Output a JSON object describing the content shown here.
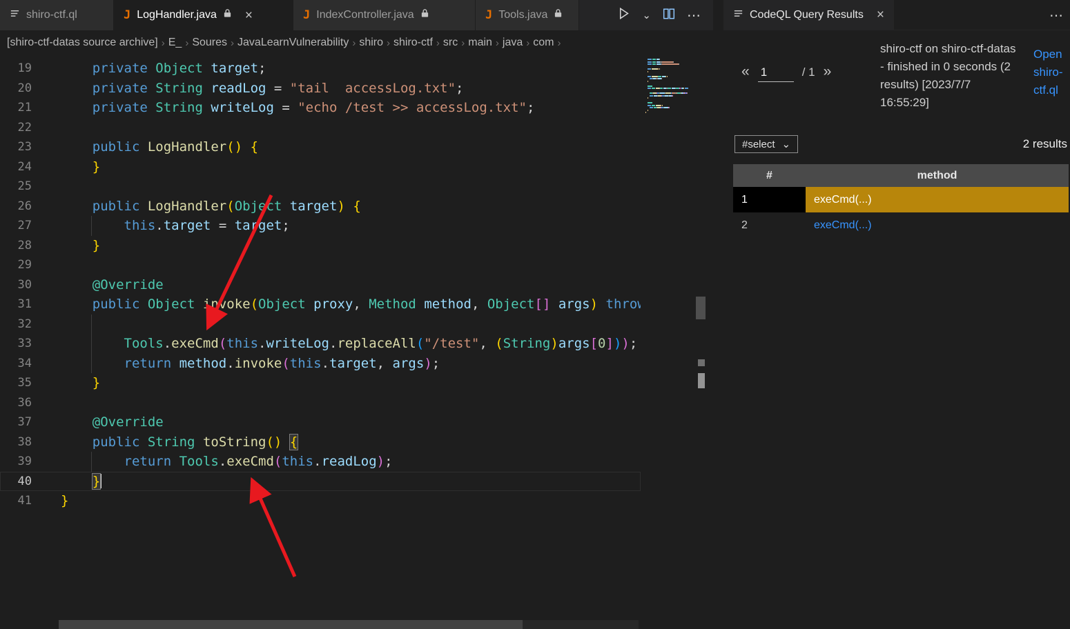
{
  "icons": {
    "java_badge": "J",
    "close": "×",
    "more": "⋯",
    "run_chevron": "⌄",
    "select_chevron": "⌄",
    "breadcrumb_separator": "›"
  },
  "colors": {
    "selected_result_bg": "#b8860b",
    "link_blue": "#3794ff",
    "annotation_arrow_red": "#e8191f",
    "java_icon_orange": "#e76f00"
  },
  "tabs": [
    {
      "label": "shiro-ctf.ql"
    },
    {
      "label": "LogHandler.java"
    },
    {
      "label": "IndexController.java"
    },
    {
      "label": "Tools.java"
    }
  ],
  "breadcrumb": {
    "items": [
      "[shiro-ctf-datas source archive]",
      "E_",
      "Soures",
      "JavaLearnVulnerability",
      "shiro",
      "shiro-ctf",
      "src",
      "main",
      "java",
      "com"
    ]
  },
  "code": {
    "lines": [
      {
        "num": "19",
        "tokens": [
          [
            "    ",
            "p"
          ],
          [
            "private",
            "kw"
          ],
          [
            " ",
            "p"
          ],
          [
            "Object",
            "type"
          ],
          [
            " ",
            "p"
          ],
          [
            "target",
            "var"
          ],
          [
            ";",
            "p"
          ]
        ]
      },
      {
        "num": "20",
        "tokens": [
          [
            "    ",
            "p"
          ],
          [
            "private",
            "kw"
          ],
          [
            " ",
            "p"
          ],
          [
            "String",
            "type"
          ],
          [
            " ",
            "p"
          ],
          [
            "readLog",
            "var"
          ],
          [
            " = ",
            "p"
          ],
          [
            "\"tail  accessLog.txt\"",
            "str"
          ],
          [
            ";",
            "p"
          ]
        ]
      },
      {
        "num": "21",
        "tokens": [
          [
            "    ",
            "p"
          ],
          [
            "private",
            "kw"
          ],
          [
            " ",
            "p"
          ],
          [
            "String",
            "type"
          ],
          [
            " ",
            "p"
          ],
          [
            "writeLog",
            "var"
          ],
          [
            " = ",
            "p"
          ],
          [
            "\"echo /test >> accessLog.txt\"",
            "str"
          ],
          [
            ";",
            "p"
          ]
        ]
      },
      {
        "num": "22",
        "tokens": []
      },
      {
        "num": "23",
        "tokens": [
          [
            "    ",
            "p"
          ],
          [
            "public",
            "kw"
          ],
          [
            " ",
            "p"
          ],
          [
            "LogHandler",
            "fn"
          ],
          [
            "()",
            "b1"
          ],
          [
            " ",
            "p"
          ],
          [
            "{",
            "b1"
          ]
        ]
      },
      {
        "num": "24",
        "tokens": [
          [
            "    ",
            "p"
          ],
          [
            "}",
            "b1"
          ]
        ]
      },
      {
        "num": "25",
        "tokens": []
      },
      {
        "num": "26",
        "tokens": [
          [
            "    ",
            "p"
          ],
          [
            "public",
            "kw"
          ],
          [
            " ",
            "p"
          ],
          [
            "LogHandler",
            "fn"
          ],
          [
            "(",
            "b1"
          ],
          [
            "Object",
            "type"
          ],
          [
            " ",
            "p"
          ],
          [
            "target",
            "var"
          ],
          [
            ")",
            "b1"
          ],
          [
            " ",
            "p"
          ],
          [
            "{",
            "b1"
          ]
        ]
      },
      {
        "num": "27",
        "tokens": [
          [
            "        ",
            "p"
          ],
          [
            "this",
            "kw"
          ],
          [
            ".",
            "p"
          ],
          [
            "target",
            "var"
          ],
          [
            " = ",
            "p"
          ],
          [
            "target",
            "var"
          ],
          [
            ";",
            "p"
          ]
        ]
      },
      {
        "num": "28",
        "tokens": [
          [
            "    ",
            "p"
          ],
          [
            "}",
            "b1"
          ]
        ]
      },
      {
        "num": "29",
        "tokens": []
      },
      {
        "num": "30",
        "tokens": [
          [
            "    ",
            "p"
          ],
          [
            "@Override",
            "type"
          ]
        ]
      },
      {
        "num": "31",
        "tokens": [
          [
            "    ",
            "p"
          ],
          [
            "public",
            "kw"
          ],
          [
            " ",
            "p"
          ],
          [
            "Object",
            "type"
          ],
          [
            " ",
            "p"
          ],
          [
            "invoke",
            "fn"
          ],
          [
            "(",
            "b1"
          ],
          [
            "Object",
            "type"
          ],
          [
            " ",
            "p"
          ],
          [
            "proxy",
            "var"
          ],
          [
            ", ",
            "p"
          ],
          [
            "Method",
            "type"
          ],
          [
            " ",
            "p"
          ],
          [
            "method",
            "var"
          ],
          [
            ", ",
            "p"
          ],
          [
            "Object",
            "type"
          ],
          [
            "[]",
            "b2"
          ],
          [
            " ",
            "p"
          ],
          [
            "args",
            "var"
          ],
          [
            ")",
            "b1"
          ],
          [
            " ",
            "p"
          ],
          [
            "throws",
            "kw"
          ]
        ]
      },
      {
        "num": "32",
        "tokens": []
      },
      {
        "num": "33",
        "tokens": [
          [
            "        ",
            "p"
          ],
          [
            "Tools",
            "type"
          ],
          [
            ".",
            "p"
          ],
          [
            "exeCmd",
            "fn"
          ],
          [
            "(",
            "b2"
          ],
          [
            "this",
            "kw"
          ],
          [
            ".",
            "p"
          ],
          [
            "writeLog",
            "var"
          ],
          [
            ".",
            "p"
          ],
          [
            "replaceAll",
            "fn"
          ],
          [
            "(",
            "b3"
          ],
          [
            "\"/test\"",
            "str"
          ],
          [
            ", ",
            "p"
          ],
          [
            "(",
            "b1"
          ],
          [
            "String",
            "type"
          ],
          [
            ")",
            "b1"
          ],
          [
            "args",
            "var"
          ],
          [
            "[",
            "b2"
          ],
          [
            "0",
            "num"
          ],
          [
            "]",
            "b2"
          ],
          [
            ")",
            "b3"
          ],
          [
            ")",
            "b2"
          ],
          [
            ";",
            "p"
          ]
        ]
      },
      {
        "num": "34",
        "tokens": [
          [
            "        ",
            "p"
          ],
          [
            "return",
            "kw"
          ],
          [
            " ",
            "p"
          ],
          [
            "method",
            "var"
          ],
          [
            ".",
            "p"
          ],
          [
            "invoke",
            "fn"
          ],
          [
            "(",
            "b2"
          ],
          [
            "this",
            "kw"
          ],
          [
            ".",
            "p"
          ],
          [
            "target",
            "var"
          ],
          [
            ", ",
            "p"
          ],
          [
            "args",
            "var"
          ],
          [
            ")",
            "b2"
          ],
          [
            ";",
            "p"
          ]
        ]
      },
      {
        "num": "35",
        "tokens": [
          [
            "    ",
            "p"
          ],
          [
            "}",
            "b1"
          ]
        ]
      },
      {
        "num": "36",
        "tokens": []
      },
      {
        "num": "37",
        "tokens": [
          [
            "    ",
            "p"
          ],
          [
            "@Override",
            "type"
          ]
        ]
      },
      {
        "num": "38",
        "tokens": [
          [
            "    ",
            "p"
          ],
          [
            "public",
            "kw"
          ],
          [
            " ",
            "p"
          ],
          [
            "String",
            "type"
          ],
          [
            " ",
            "p"
          ],
          [
            "toString",
            "fn"
          ],
          [
            "()",
            "b1"
          ],
          [
            " ",
            "p"
          ],
          [
            "{",
            "b1 match"
          ]
        ]
      },
      {
        "num": "39",
        "tokens": [
          [
            "        ",
            "p"
          ],
          [
            "return",
            "kw"
          ],
          [
            " ",
            "p"
          ],
          [
            "Tools",
            "type"
          ],
          [
            ".",
            "p"
          ],
          [
            "exeCmd",
            "fn"
          ],
          [
            "(",
            "b2"
          ],
          [
            "this",
            "kw"
          ],
          [
            ".",
            "p"
          ],
          [
            "readLog",
            "var"
          ],
          [
            ")",
            "b2"
          ],
          [
            ";",
            "p"
          ]
        ]
      },
      {
        "num": "40",
        "current": true,
        "cursor": true,
        "tokens": [
          [
            "    ",
            "p"
          ],
          [
            "}",
            "b1 match"
          ]
        ]
      },
      {
        "num": "41",
        "tokens": [
          [
            "}",
            "b1"
          ]
        ]
      }
    ]
  },
  "results_panel": {
    "tab_title": "CodeQL Query Results",
    "pagination": {
      "prev": "«",
      "page": "1",
      "of": "/ 1",
      "next": "»"
    },
    "status_text": "shiro-ctf on shiro-ctf-datas - finished in 0 seconds (2 results) [2023/7/7 16:55:29]",
    "open_link": "Open shiro-ctf.ql",
    "select_label": "#select",
    "results_count": "2 results",
    "table": {
      "headers": [
        "#",
        "method"
      ],
      "rows": [
        {
          "num": "1",
          "method": "exeCmd(...)",
          "selected": true
        },
        {
          "num": "2",
          "method": "exeCmd(...)",
          "selected": false
        }
      ]
    }
  }
}
